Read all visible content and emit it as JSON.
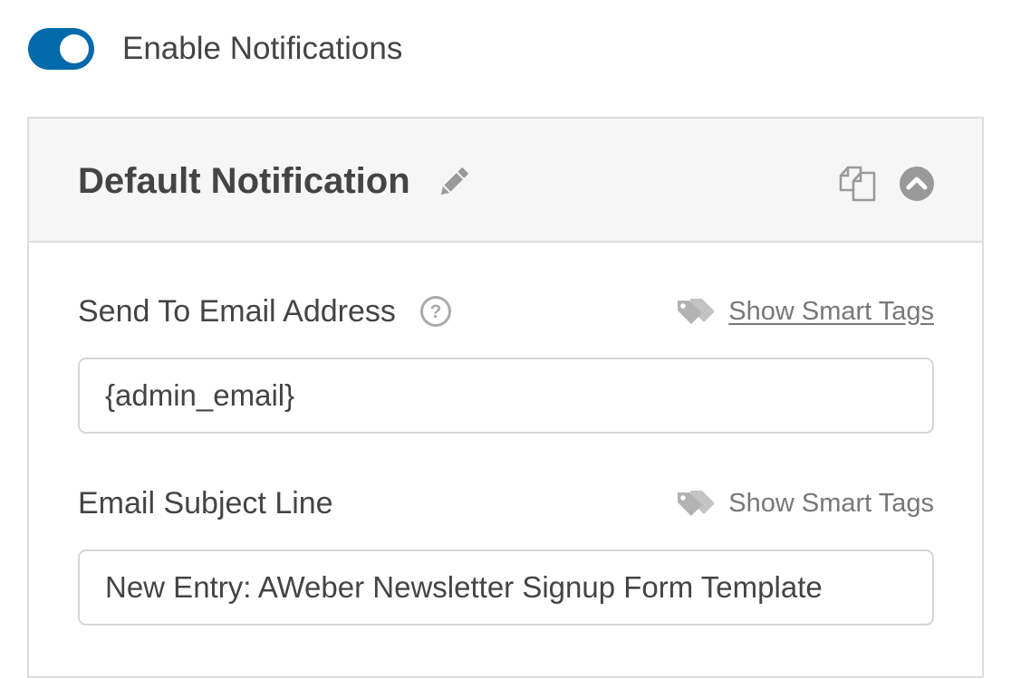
{
  "notifications_toggle": {
    "label": "Enable Notifications",
    "enabled": true,
    "accent_color": "#036aab"
  },
  "notification_panel": {
    "title": "Default Notification",
    "icons": {
      "edit": "pencil-icon",
      "duplicate": "duplicate-icon",
      "collapse": "chevron-up-circle-icon"
    },
    "fields": [
      {
        "label": "Send To Email Address",
        "has_help": true,
        "help_icon": "question-circle-icon",
        "smart_tags_label": "Show Smart Tags",
        "smart_tags_icon": "tags-icon",
        "value": "{admin_email}"
      },
      {
        "label": "Email Subject Line",
        "has_help": false,
        "smart_tags_label": "Show Smart Tags",
        "smart_tags_icon": "tags-icon",
        "value": "New Entry: AWeber Newsletter Signup Form Template"
      }
    ]
  }
}
